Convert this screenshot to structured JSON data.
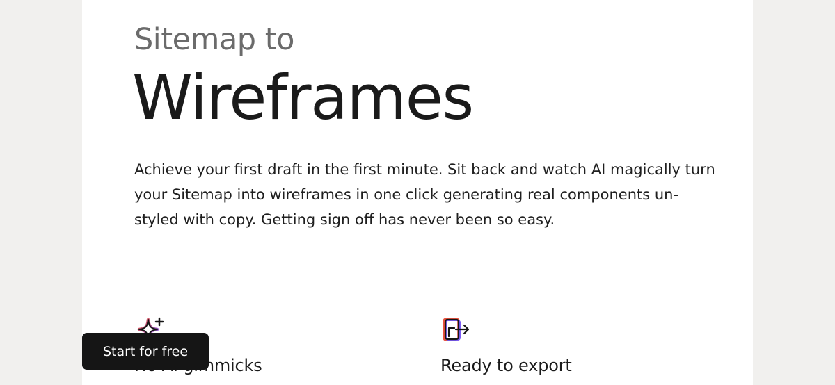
{
  "hero": {
    "eyebrow": "Sitemap to",
    "title": "Wireframes",
    "description": "Achieve your first draft in the first minute. Sit back and watch AI magically turn your Sitemap into wireframes in one click generating real components un-styled with copy. Getting sign off has never been so easy."
  },
  "features": [
    {
      "icon": "sparkle-plus-icon",
      "title": "No AI gimmicks"
    },
    {
      "icon": "export-arrow-icon",
      "title": "Ready to export"
    }
  ],
  "cta": {
    "label": "Start for free"
  },
  "colors": {
    "background": "#f1f0ee",
    "card": "#ffffff",
    "text": "#1a1a1a",
    "muted": "#6b6b6b",
    "cta_bg": "#151515",
    "icon_red": "#e8533f",
    "icon_purple": "#7b5cf5"
  }
}
